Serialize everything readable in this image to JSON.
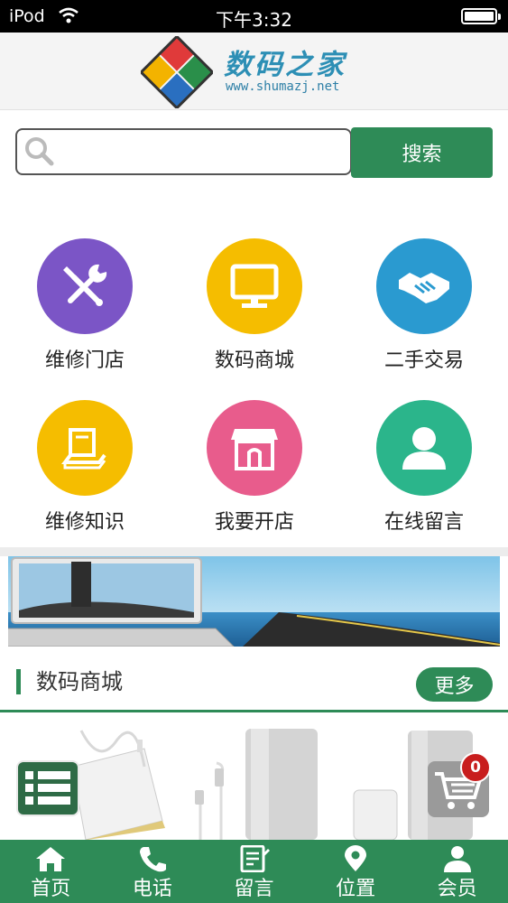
{
  "status_bar": {
    "carrier": "iPod",
    "time": "下午3:32"
  },
  "header": {
    "logo_title": "数码之家",
    "logo_url": "www.shumazj.net"
  },
  "search": {
    "placeholder": "",
    "button_label": "搜索"
  },
  "grid": [
    {
      "label": "维修门店",
      "color": "#7b55c6",
      "icon": "repair-tools-icon"
    },
    {
      "label": "数码商城",
      "color": "#f5bd00",
      "icon": "monitor-icon"
    },
    {
      "label": "二手交易",
      "color": "#2a9ad0",
      "icon": "handshake-icon"
    },
    {
      "label": "维修知识",
      "color": "#f5bd00",
      "icon": "book-icon"
    },
    {
      "label": "我要开店",
      "color": "#e85c8c",
      "icon": "storefront-icon"
    },
    {
      "label": "在线留言",
      "color": "#2bb58b",
      "icon": "user-icon"
    }
  ],
  "section": {
    "title": "数码商城",
    "more_label": "更多"
  },
  "cart": {
    "count": "0"
  },
  "bottom_nav": [
    {
      "label": "首页",
      "icon": "home-icon"
    },
    {
      "label": "电话",
      "icon": "phone-icon"
    },
    {
      "label": "留言",
      "icon": "message-icon"
    },
    {
      "label": "位置",
      "icon": "location-icon"
    },
    {
      "label": "会员",
      "icon": "member-icon"
    }
  ],
  "colors": {
    "primary": "#2e8b57",
    "badge": "#c81e1e"
  }
}
